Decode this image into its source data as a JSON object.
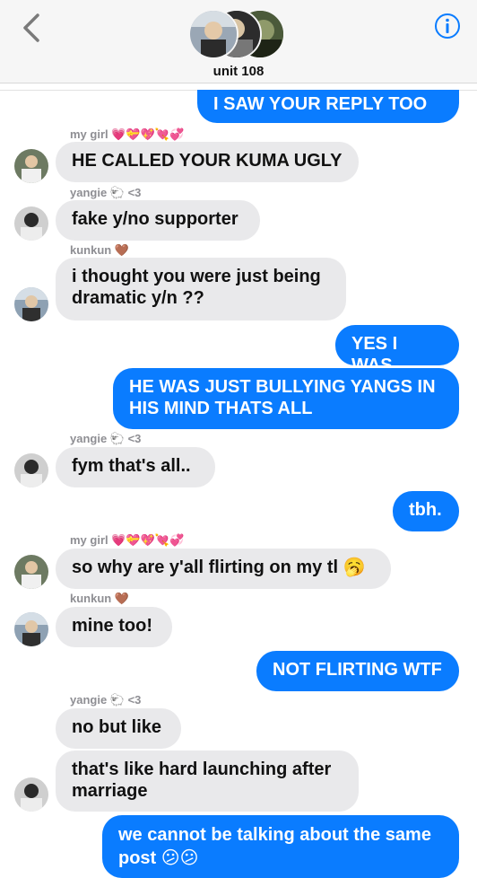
{
  "header": {
    "group_name": "unit 108"
  },
  "messages": [
    {
      "dir": "out",
      "text": "I SAW YOUR REPLY TOO ......"
    },
    {
      "dir": "in",
      "sender": "my girl 💗💝💖💘💞",
      "text": "HE CALLED YOUR KUMA UGLY"
    },
    {
      "dir": "in",
      "sender": "yangie 🐑 <3",
      "text": "fake y/no supporter"
    },
    {
      "dir": "in",
      "sender": "kunkun 🤎",
      "text": "i thought you were just being\ndramatic y/n ??"
    },
    {
      "dir": "out",
      "text": "YES I WAS"
    },
    {
      "dir": "out",
      "text": "HE WAS JUST BULLYING YANGS IN\nHIS MIND THATS ALL"
    },
    {
      "dir": "in",
      "sender": "yangie 🐑 <3",
      "text": "fym that's all.."
    },
    {
      "dir": "out",
      "text": "tbh."
    },
    {
      "dir": "in",
      "sender": "my girl 💗💝💖💘💞",
      "text": "so why are y'all flirting on my tl 🥱"
    },
    {
      "dir": "in",
      "sender": "kunkun 🤎",
      "text": "mine too!"
    },
    {
      "dir": "out",
      "text": "NOT FLIRTING WTF"
    },
    {
      "dir": "in",
      "sender": "yangie 🐑 <3",
      "text": "no but like"
    },
    {
      "dir": "in",
      "text": "that's like hard launching after\nmarriage"
    },
    {
      "dir": "out",
      "text": "we cannot be talking about the same\npost 😕😕"
    }
  ],
  "colors": {
    "outgoing": "#0a7cff",
    "incoming": "#e9e9eb",
    "accent": "#0a7cff"
  }
}
